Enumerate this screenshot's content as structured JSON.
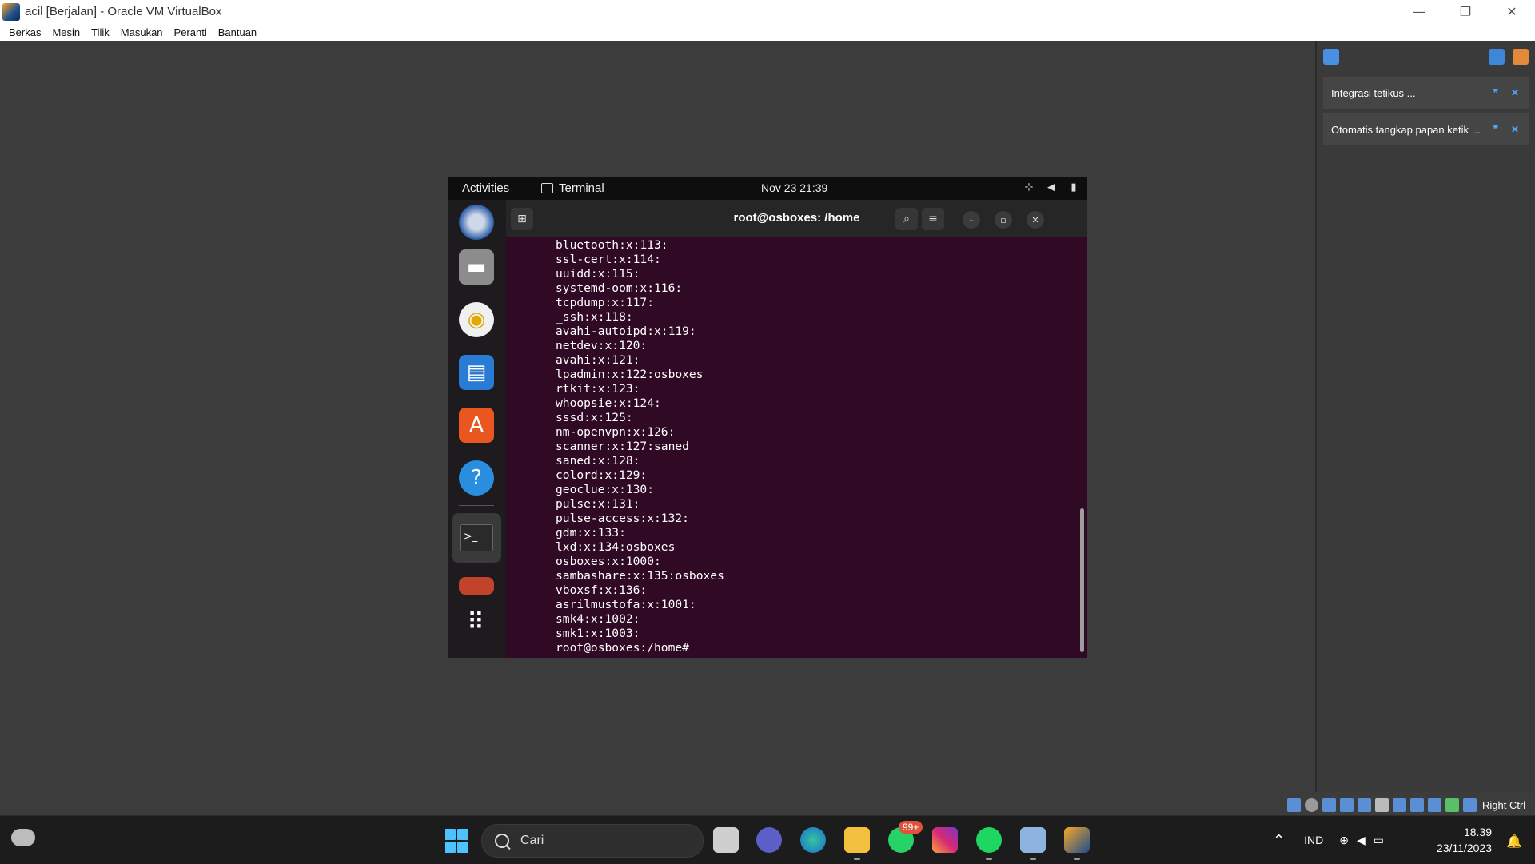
{
  "window": {
    "title": "acil [Berjalan] - Oracle VM VirtualBox",
    "controls": {
      "minimize": "—",
      "restore": "❐",
      "close": "✕"
    }
  },
  "menubar": [
    "Berkas",
    "Mesin",
    "Tilik",
    "Masukan",
    "Peranti",
    "Bantuan"
  ],
  "notifications": {
    "items": [
      {
        "text": "Integrasi tetikus ..."
      },
      {
        "text": "Otomatis tangkap papan ketik ..."
      }
    ]
  },
  "statusbar": {
    "host_key": "Right Ctrl"
  },
  "guest": {
    "topbar": {
      "activities": "Activities",
      "app": "Terminal",
      "clock": "Nov 23  21:39"
    },
    "terminal": {
      "title": "root@osboxes: /home",
      "lines": [
        "bluetooth:x:113:",
        "ssl-cert:x:114:",
        "uuidd:x:115:",
        "systemd-oom:x:116:",
        "tcpdump:x:117:",
        "_ssh:x:118:",
        "avahi-autoipd:x:119:",
        "netdev:x:120:",
        "avahi:x:121:",
        "lpadmin:x:122:osboxes",
        "rtkit:x:123:",
        "whoopsie:x:124:",
        "sssd:x:125:",
        "nm-openvpn:x:126:",
        "scanner:x:127:saned",
        "saned:x:128:",
        "colord:x:129:",
        "geoclue:x:130:",
        "pulse:x:131:",
        "pulse-access:x:132:",
        "gdm:x:133:",
        "lxd:x:134:osboxes",
        "osboxes:x:1000:",
        "sambashare:x:135:osboxes",
        "vboxsf:x:136:",
        "asrilmustofa:x:1001:",
        "smk4:x:1002:",
        "smk1:x:1003:",
        "root@osboxes:/home#"
      ]
    }
  },
  "taskbar": {
    "search_placeholder": "Cari",
    "whatsapp_badge": "99+",
    "language": "IND",
    "time": "18.39",
    "date": "23/11/2023"
  }
}
